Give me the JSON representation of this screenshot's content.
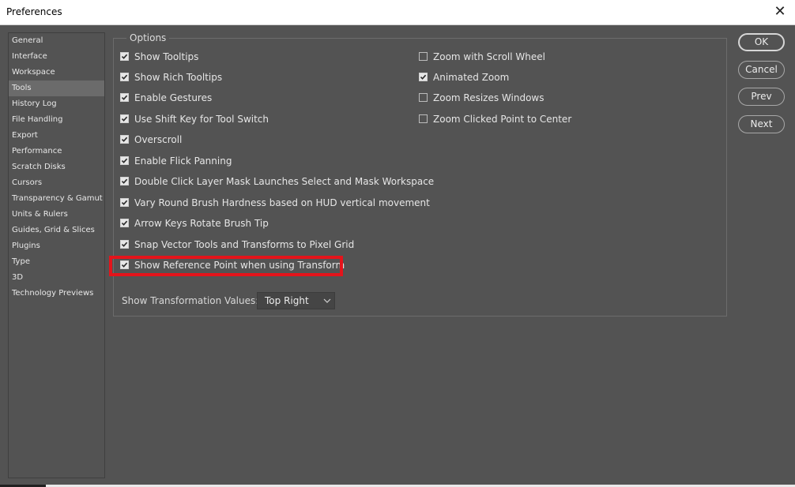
{
  "window": {
    "title": "Preferences",
    "close_glyph": "✕"
  },
  "sidebar": {
    "items": [
      {
        "label": "General",
        "active": false
      },
      {
        "label": "Interface",
        "active": false
      },
      {
        "label": "Workspace",
        "active": false
      },
      {
        "label": "Tools",
        "active": true
      },
      {
        "label": "History Log",
        "active": false
      },
      {
        "label": "File Handling",
        "active": false
      },
      {
        "label": "Export",
        "active": false
      },
      {
        "label": "Performance",
        "active": false
      },
      {
        "label": "Scratch Disks",
        "active": false
      },
      {
        "label": "Cursors",
        "active": false
      },
      {
        "label": "Transparency & Gamut",
        "active": false
      },
      {
        "label": "Units & Rulers",
        "active": false
      },
      {
        "label": "Guides, Grid & Slices",
        "active": false
      },
      {
        "label": "Plugins",
        "active": false
      },
      {
        "label": "Type",
        "active": false
      },
      {
        "label": "3D",
        "active": false
      },
      {
        "label": "Technology Previews",
        "active": false
      }
    ]
  },
  "options": {
    "title": "Options",
    "left_column": [
      {
        "label": "Show Tooltips",
        "checked": true
      },
      {
        "label": "Show Rich Tooltips",
        "checked": true
      },
      {
        "label": "Enable Gestures",
        "checked": true
      },
      {
        "label": "Use Shift Key for Tool Switch",
        "checked": true
      },
      {
        "label": "Overscroll",
        "checked": true
      },
      {
        "label": "Enable Flick Panning",
        "checked": true
      },
      {
        "label": "Double Click Layer Mask Launches Select and Mask Workspace",
        "checked": true
      },
      {
        "label": "Vary Round Brush Hardness based on HUD vertical movement",
        "checked": true
      },
      {
        "label": "Arrow Keys Rotate Brush Tip",
        "checked": true
      },
      {
        "label": "Snap Vector Tools and Transforms to Pixel Grid",
        "checked": true
      },
      {
        "label": "Show Reference Point when using Transform",
        "checked": true
      }
    ],
    "right_column": [
      {
        "label": "Zoom with Scroll Wheel",
        "checked": false
      },
      {
        "label": "Animated Zoom",
        "checked": true
      },
      {
        "label": "Zoom Resizes Windows",
        "checked": false
      },
      {
        "label": "Zoom Clicked Point to Center",
        "checked": false
      }
    ],
    "transformation_values": {
      "label": "Show Transformation Values:",
      "selected": "Top Right"
    }
  },
  "buttons": {
    "ok": "OK",
    "cancel": "Cancel",
    "prev": "Prev",
    "next": "Next"
  },
  "colors": {
    "background": "#535353",
    "highlight": "#e4141b",
    "active_item": "#6b6b6b"
  }
}
